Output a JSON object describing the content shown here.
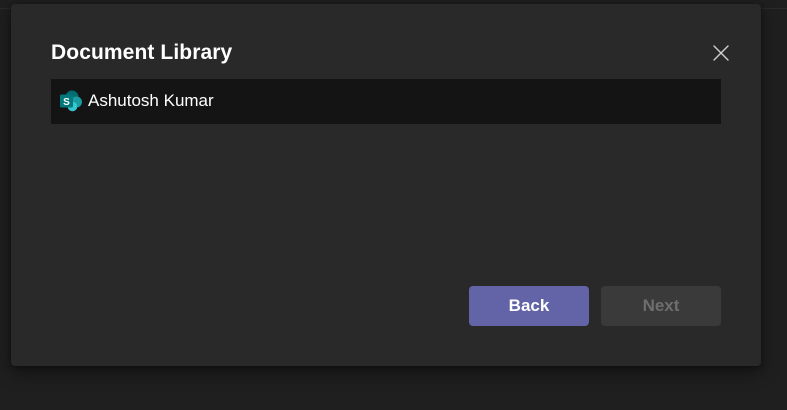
{
  "dialog": {
    "title": "Document Library",
    "close_icon": "close-icon",
    "items": [
      {
        "label": "Ashutosh Kumar",
        "icon": "sharepoint-icon"
      }
    ],
    "buttons": {
      "back_label": "Back",
      "next_label": "Next",
      "next_disabled": true
    }
  },
  "colors": {
    "primary_button": "#6264a7",
    "dialog_background": "#292929",
    "list_background": "#141414",
    "disabled_button": "#3a3a3a"
  }
}
